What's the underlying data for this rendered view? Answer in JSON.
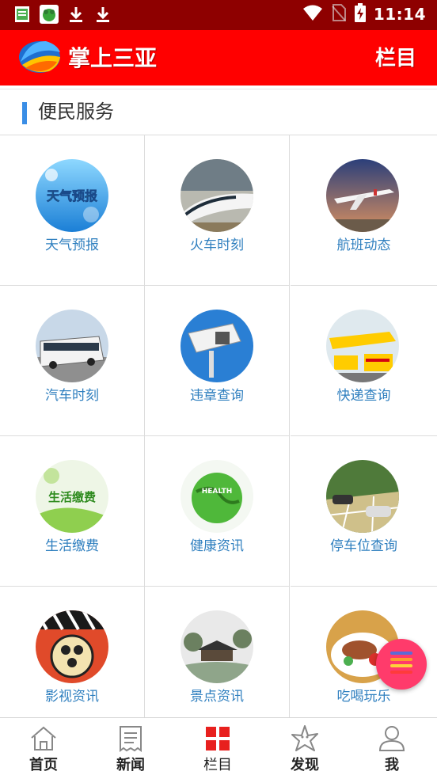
{
  "status_bar": {
    "time": "11:14",
    "left_icons": [
      "notes-icon",
      "frog-icon",
      "download-icon",
      "download-icon"
    ],
    "right_icons": [
      "wifi-icon",
      "no-sim-icon",
      "battery-charging-icon"
    ]
  },
  "app_bar": {
    "title": "掌上三亚",
    "menu_label": "栏目",
    "brand_color": "#ff0000"
  },
  "section": {
    "title": "便民服务",
    "accent_color": "#3a8ee6"
  },
  "services": [
    {
      "label": "天气预报",
      "icon": "weather-icon",
      "img_text": "天气预报"
    },
    {
      "label": "火车时刻",
      "icon": "train-icon"
    },
    {
      "label": "航班动态",
      "icon": "airplane-icon"
    },
    {
      "label": "汽车时刻",
      "icon": "bus-icon"
    },
    {
      "label": "违章查询",
      "icon": "traffic-camera-icon"
    },
    {
      "label": "快递查询",
      "icon": "delivery-truck-icon"
    },
    {
      "label": "生活缴费",
      "icon": "utility-payment-icon",
      "img_text": "生活缴费"
    },
    {
      "label": "健康资讯",
      "icon": "health-globe-icon",
      "img_text": "HEALTH"
    },
    {
      "label": "停车位查询",
      "icon": "parking-icon"
    },
    {
      "label": "影视资讯",
      "icon": "film-reel-icon"
    },
    {
      "label": "景点资讯",
      "icon": "pavilion-icon"
    },
    {
      "label": "吃喝玩乐",
      "icon": "food-plate-icon"
    }
  ],
  "bottom_nav": [
    {
      "label": "首页",
      "icon": "home-icon",
      "active": false
    },
    {
      "label": "新闻",
      "icon": "news-icon",
      "active": false
    },
    {
      "label": "栏目",
      "icon": "grid-icon",
      "active": true
    },
    {
      "label": "发现",
      "icon": "starfish-icon",
      "active": false
    },
    {
      "label": "我",
      "icon": "user-icon",
      "active": false
    }
  ]
}
